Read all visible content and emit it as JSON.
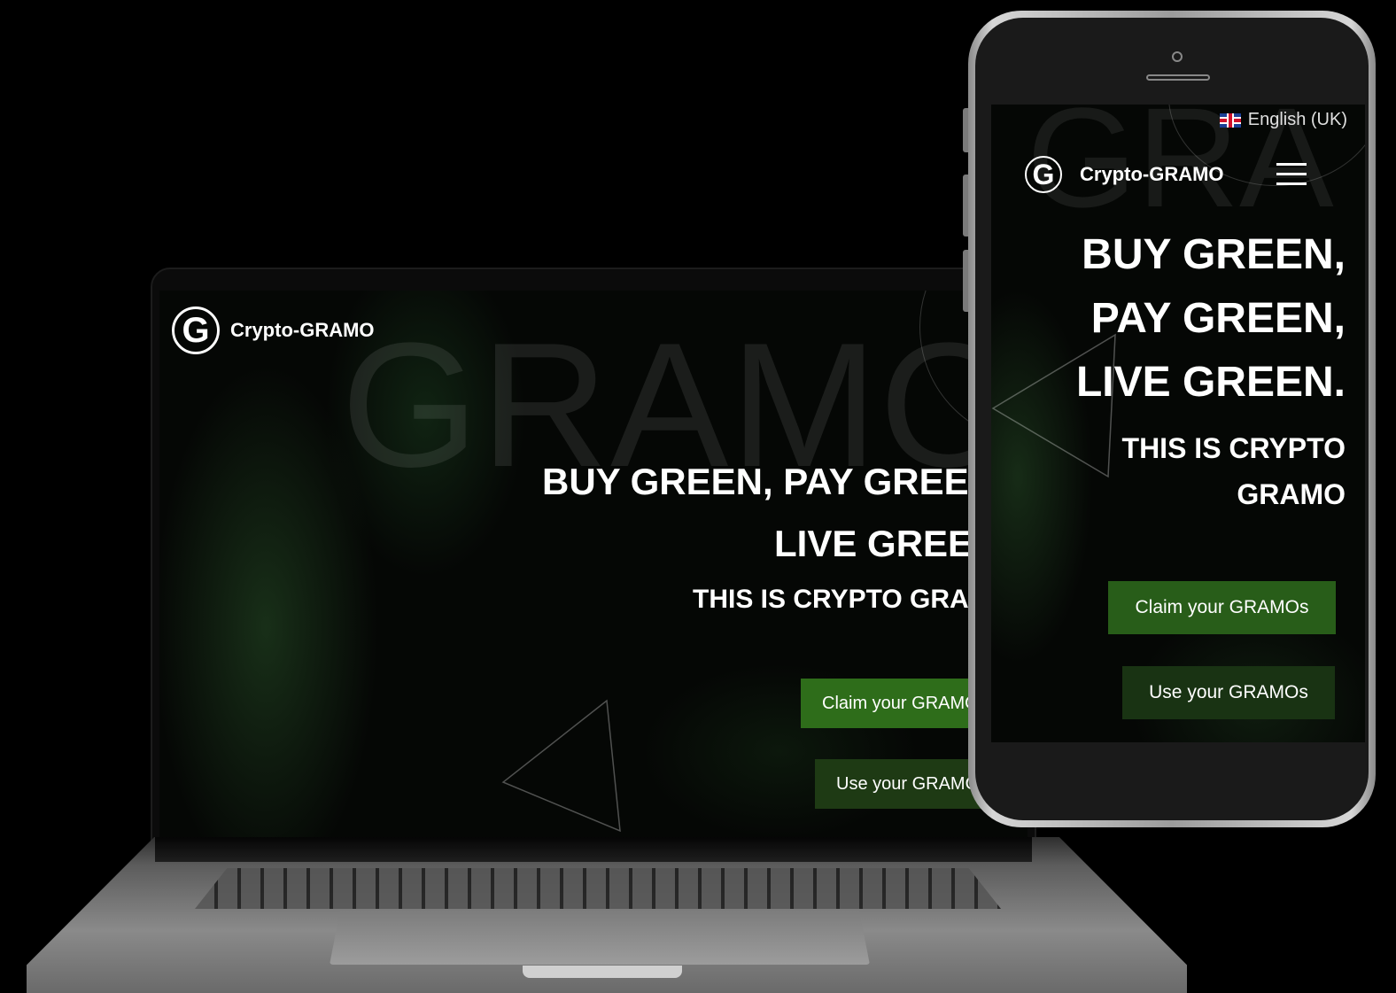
{
  "brand": {
    "name": "Crypto-GRAMO",
    "logo_letter": "G",
    "watermark": "GRAMO",
    "accent_color": "#2e6d1a",
    "dark_green": "#1e3a14"
  },
  "laptop": {
    "hero": {
      "line1": "BUY GREEN, PAY GREEN,",
      "line2": "LIVE GREEN.",
      "subtitle": "THIS IS CRYPTO GRAMO"
    },
    "buttons": {
      "claim_label": "Claim your GRAMOs",
      "use_label": "Use your GRAMOs"
    }
  },
  "phone": {
    "language": "English (UK)",
    "flag_icon": "uk-flag-icon",
    "menu_icon": "hamburger-menu-icon",
    "watermark": "GRA",
    "hero": {
      "line1": "BUY GREEN,",
      "line2": "PAY GREEN,",
      "line3": "LIVE GREEN.",
      "subtitle1": "THIS IS CRYPTO",
      "subtitle2": "GRAMO"
    },
    "buttons": {
      "claim_label": "Claim your GRAMOs",
      "use_label": "Use your GRAMOs"
    }
  }
}
